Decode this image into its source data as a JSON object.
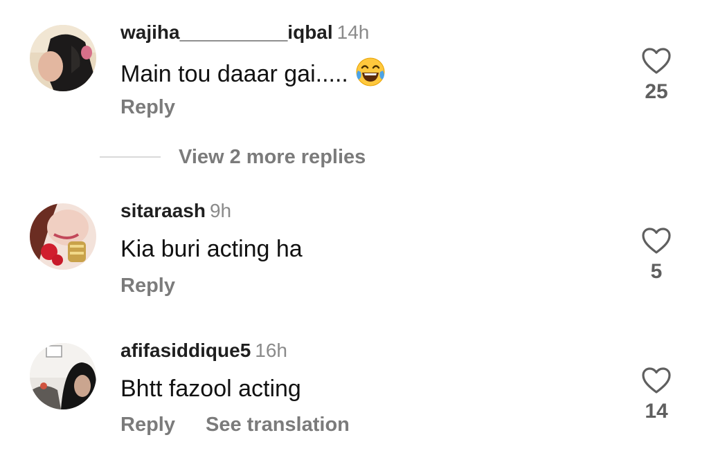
{
  "comments": [
    {
      "username": "wajiha__________iqbal",
      "time": "14h",
      "text": "Main tou daaar gai.....",
      "emoji": "joy-tears-emoji",
      "reply_label": "Reply",
      "likes": "25"
    },
    {
      "username": "sitaraash",
      "time": "9h",
      "text": "Kia buri acting ha",
      "reply_label": "Reply",
      "likes": "5"
    },
    {
      "username": "afifasiddique5",
      "time": "16h",
      "text": "Bhtt fazool acting",
      "reply_label": "Reply",
      "translation_label": "See translation",
      "likes": "14"
    }
  ],
  "view_more_replies": "View 2 more replies",
  "icons": {
    "like": "heart-outline-icon"
  },
  "colors": {
    "secondary_text": "#7b7b7b",
    "timestamp": "#8a8a8a",
    "like_count": "#5f5f5f"
  }
}
